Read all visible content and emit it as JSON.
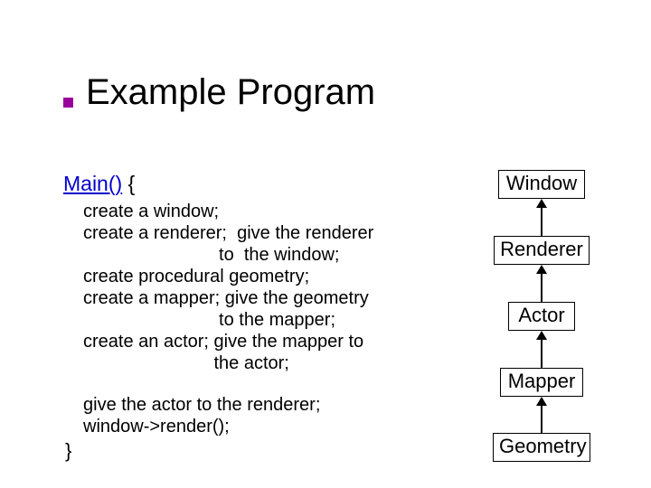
{
  "title": "Example Program",
  "main": {
    "fn_name": "Main()",
    "open_brace": " {",
    "body1": "create a window;\ncreate a renderer;  give the renderer\n                           to  the window;\ncreate procedural geometry;\ncreate a mapper; give the geometry\n                           to the mapper;\ncreate an actor; give the mapper to\n                          the actor;",
    "body2": "give the actor to the renderer;\nwindow->render();",
    "close_brace": "}"
  },
  "diagram": {
    "window": "Window",
    "renderer": "Renderer",
    "actor": "Actor",
    "mapper": "Mapper",
    "geometry": "Geometry"
  }
}
